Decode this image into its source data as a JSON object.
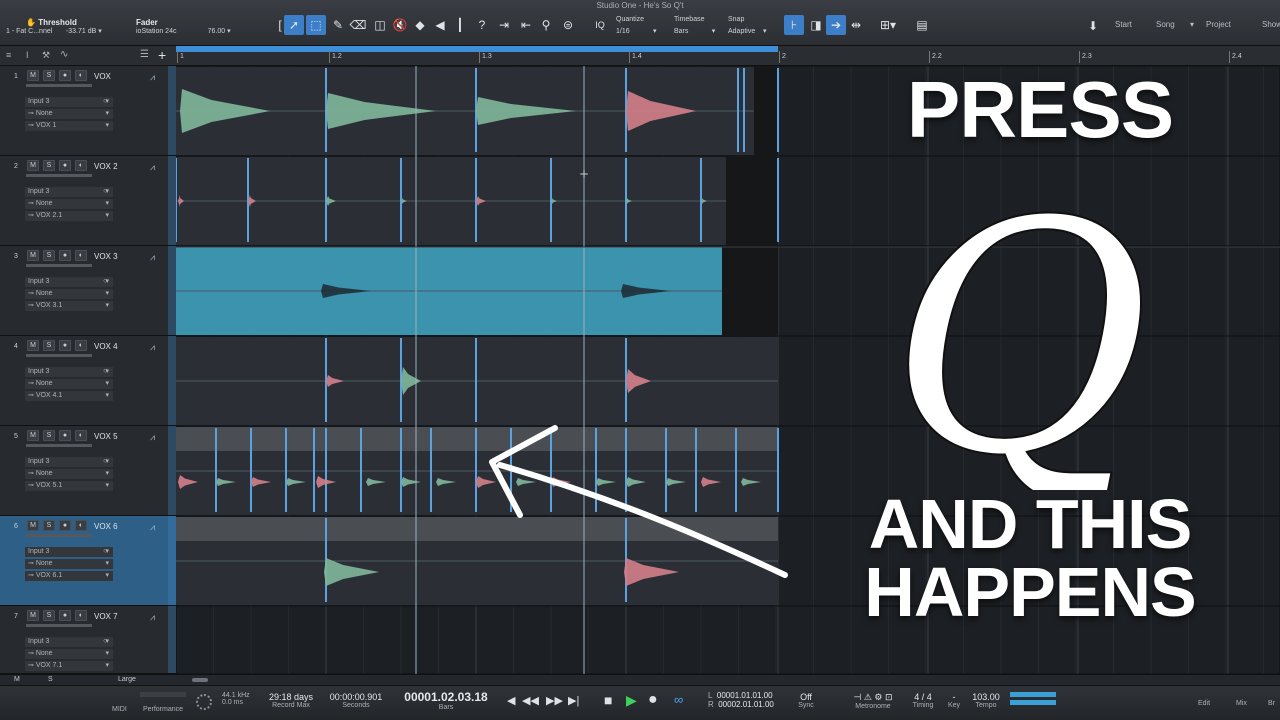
{
  "window": {
    "title": "Studio One - He's So Q't"
  },
  "toolbar": {
    "threshold": {
      "label": "Threshold",
      "channel": "1 - Fat C...nnel",
      "value": "-33.71 dB"
    },
    "fader": {
      "label": "Fader",
      "device": "ioStation 24c",
      "value": "76.00"
    },
    "quantize": {
      "label": "Quantize",
      "value": "1/16"
    },
    "timebase": {
      "label": "Timebase",
      "value": "Bars"
    },
    "snap": {
      "label": "Snap",
      "value": "Adaptive"
    },
    "iq": "IQ",
    "nav": [
      "Start",
      "Song",
      "Project",
      "Show"
    ]
  },
  "ruler": {
    "ticks": [
      "1",
      "1.2",
      "1.3",
      "1.4",
      "2",
      "2.2",
      "2.3",
      "2.4"
    ]
  },
  "tracks": [
    {
      "num": "1",
      "name": "VOX",
      "input": "Input 3",
      "send": "None",
      "output": "VOX 1"
    },
    {
      "num": "2",
      "name": "VOX 2",
      "input": "Input 3",
      "send": "None",
      "output": "VOX 2.1"
    },
    {
      "num": "3",
      "name": "VOX 3",
      "input": "Input 3",
      "send": "None",
      "output": "VOX 3.1"
    },
    {
      "num": "4",
      "name": "VOX 4",
      "input": "Input 3",
      "send": "None",
      "output": "VOX 4.1"
    },
    {
      "num": "5",
      "name": "VOX 5",
      "input": "Input 3",
      "send": "None",
      "output": "VOX 5.1"
    },
    {
      "num": "6",
      "name": "VOX 6",
      "input": "Input 3",
      "send": "None",
      "output": "VOX 6.1"
    },
    {
      "num": "7",
      "name": "VOX 7",
      "input": "Input 3",
      "send": "None",
      "output": "VOX 7.1"
    }
  ],
  "track_buttons": {
    "mute": "M",
    "solo": "S"
  },
  "overlay": {
    "line1": "PRESS",
    "letter": "Q",
    "line2": "AND THIS",
    "line3": "HAPPENS"
  },
  "statusbar": {
    "m": "M",
    "s": "S",
    "size": "Large"
  },
  "transport": {
    "midi": "MIDI",
    "performance": "Performance",
    "sample_rate": "44.1 kHz",
    "latency": "0.0 ms",
    "record_max": "29:18 days",
    "record_max_label": "Record Max",
    "seconds": "00:00:00.901",
    "seconds_label": "Seconds",
    "bars": "00001.02.03.18",
    "bars_label": "Bars",
    "loop_l": "00001.01.01.00",
    "loop_r": "00002.01.01.00",
    "l_label": "L",
    "r_label": "R",
    "sync": "Off",
    "sync_label": "Sync",
    "metronome": "Metronome",
    "timing": "4 / 4",
    "timing_label": "Timing",
    "key": "-",
    "key_label": "Key",
    "tempo": "103.00",
    "tempo_label": "Tempo",
    "edit": "Edit",
    "mix": "Mix",
    "browse": "Br"
  }
}
